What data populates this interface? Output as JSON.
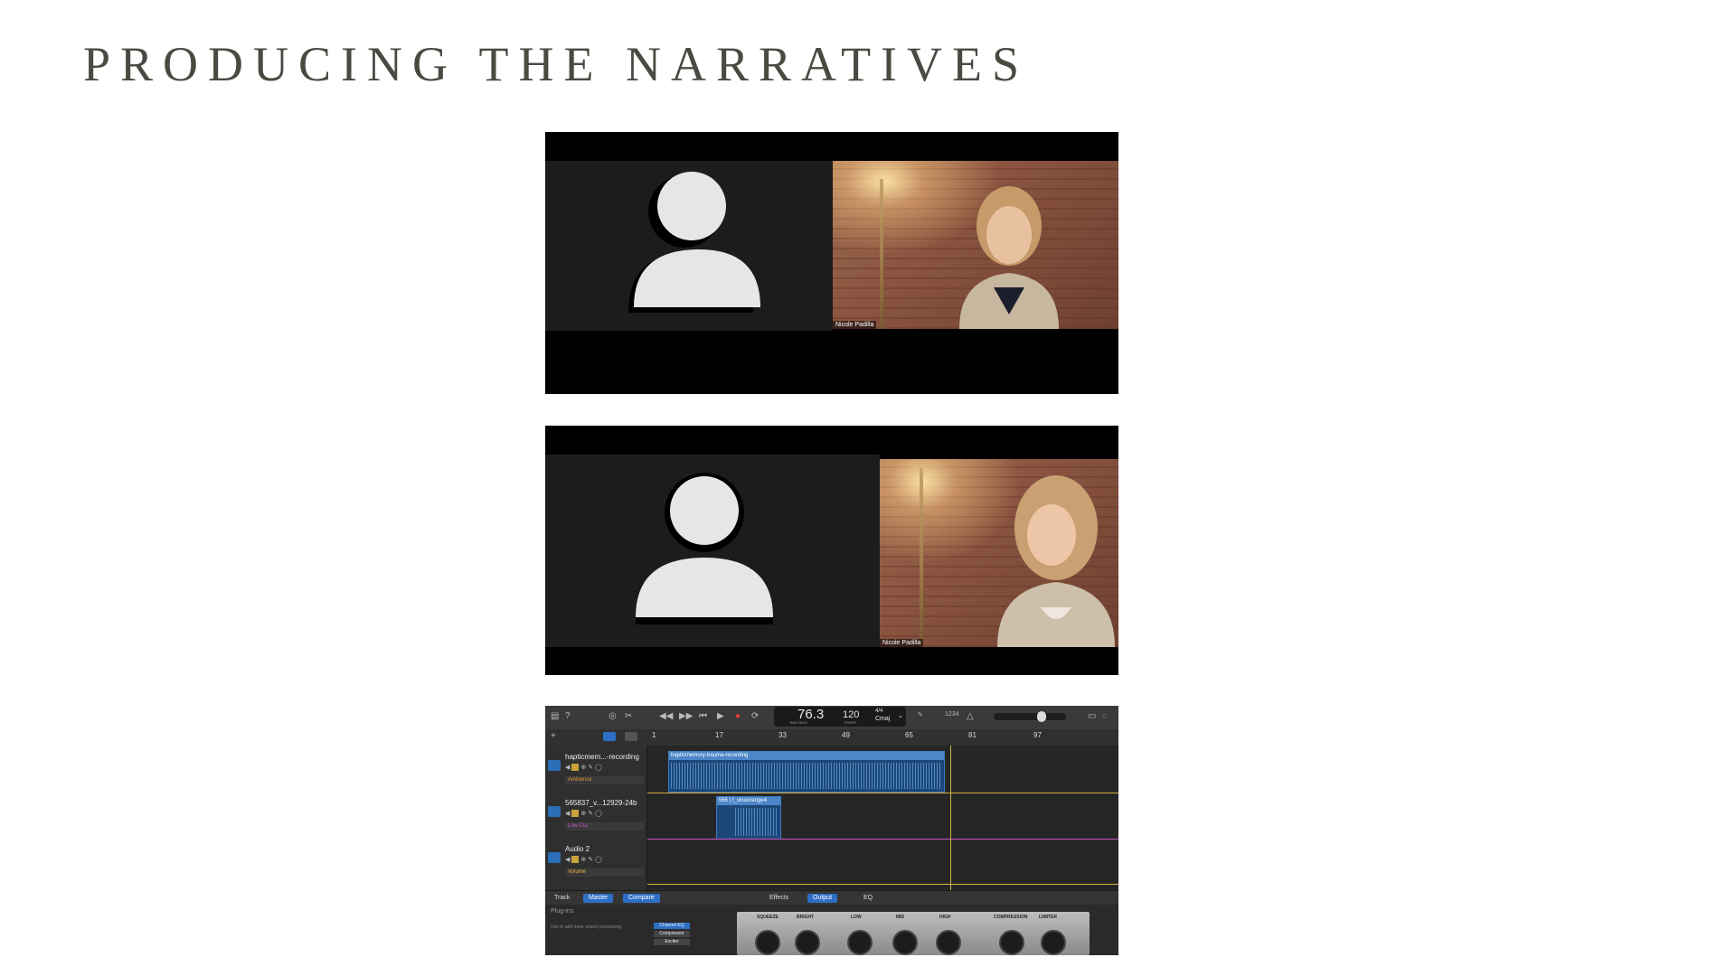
{
  "slide": {
    "title": "PRODUCING THE NARRATIVES"
  },
  "screenshot1": {
    "participant_name": "Nicole Padilla"
  },
  "screenshot2": {
    "participant_name": "Nicole Padilla"
  },
  "daw": {
    "lcd": {
      "position": "76.3",
      "position_labels": "BAR   BEAT",
      "tempo": "120",
      "tempo_label": "TEMPO",
      "key": "Cmaj",
      "signature": "4/4"
    },
    "lcd_extra": "1234",
    "ruler_marks": [
      "1",
      "17",
      "33",
      "49",
      "65",
      "81",
      "97"
    ],
    "tracks": [
      {
        "name": "hapticmem...-recording",
        "plugin": "Ambience",
        "plugin_color": "#e0923a"
      },
      {
        "name": "565837_v...12929-24b",
        "plugin": "Low Cut",
        "plugin_color": "#c456c9"
      },
      {
        "name": "Audio 2",
        "plugin": "Volume",
        "plugin_color": "#e3b23c"
      }
    ],
    "regions": [
      {
        "label": "hapticmemory-trauma-recording"
      },
      {
        "label": "565",
        "label2": "f_vinoorange4"
      }
    ],
    "bottom_tabs_left": [
      "Track",
      "Master",
      "Compare"
    ],
    "bottom_tabs_right": [
      "Effects",
      "Output",
      "EQ"
    ],
    "plugins_label": "Plug-ins",
    "plugins_hint": "Use to add more sound processing.",
    "plugin_slots": [
      "Channel EQ",
      "Compressor",
      "Exciter"
    ],
    "eq_knobs": [
      "SQUEEZE",
      "BRIGHT",
      "LOW",
      "MID",
      "HIGH",
      "COMPRESSION",
      "LIMITER"
    ]
  }
}
